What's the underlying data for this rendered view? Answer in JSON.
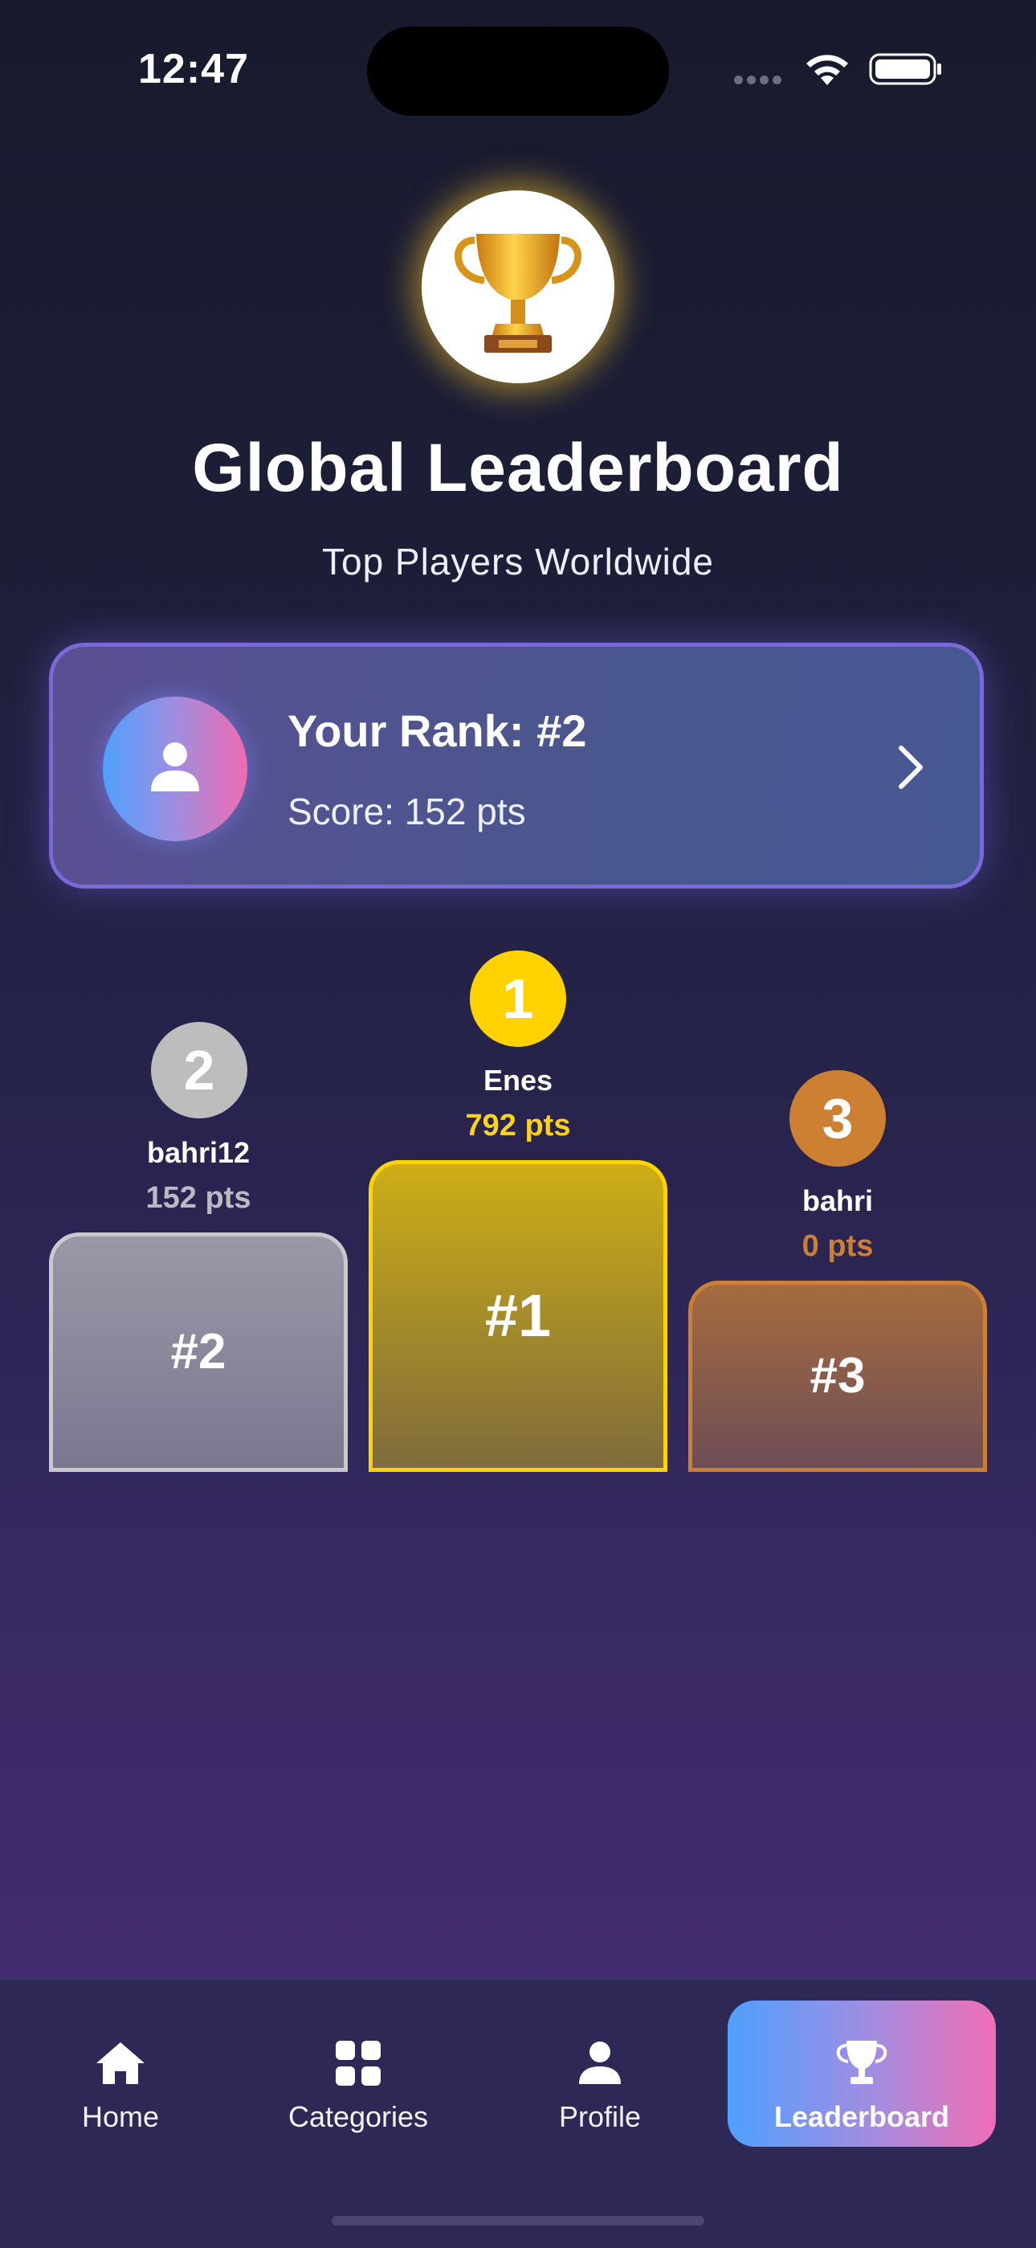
{
  "status_bar": {
    "time": "12:47"
  },
  "header": {
    "trophy_icon": "trophy-icon",
    "title": "Global Leaderboard",
    "subtitle": "Top Players Worldwide"
  },
  "rank_card": {
    "title": "Your Rank: #2",
    "score": "Score: 152 pts",
    "avatar_icon": "person-icon",
    "chevron_icon": "chevron-right-icon"
  },
  "podium": {
    "second": {
      "badge": "2",
      "name": "bahri12",
      "points": "152 pts",
      "label": "#2",
      "color": "#bdbdbd"
    },
    "first": {
      "badge": "1",
      "name": "Enes",
      "points": "792 pts",
      "label": "#1",
      "color": "#ffd200"
    },
    "third": {
      "badge": "3",
      "name": "bahri",
      "points": "0 pts",
      "label": "#3",
      "color": "#cd7f32"
    }
  },
  "tab_bar": {
    "items": [
      {
        "label": "Home",
        "icon": "home-icon",
        "active": false
      },
      {
        "label": "Categories",
        "icon": "grid-icon",
        "active": false
      },
      {
        "label": "Profile",
        "icon": "person-icon",
        "active": false
      },
      {
        "label": "Leaderboard",
        "icon": "trophy-icon",
        "active": true
      }
    ]
  },
  "colors": {
    "accent_gradient_start": "#4fa0ff",
    "accent_gradient_end": "#f06eb5",
    "gold": "#ffd200",
    "silver": "#bdbdbd",
    "bronze": "#cd7f32"
  }
}
